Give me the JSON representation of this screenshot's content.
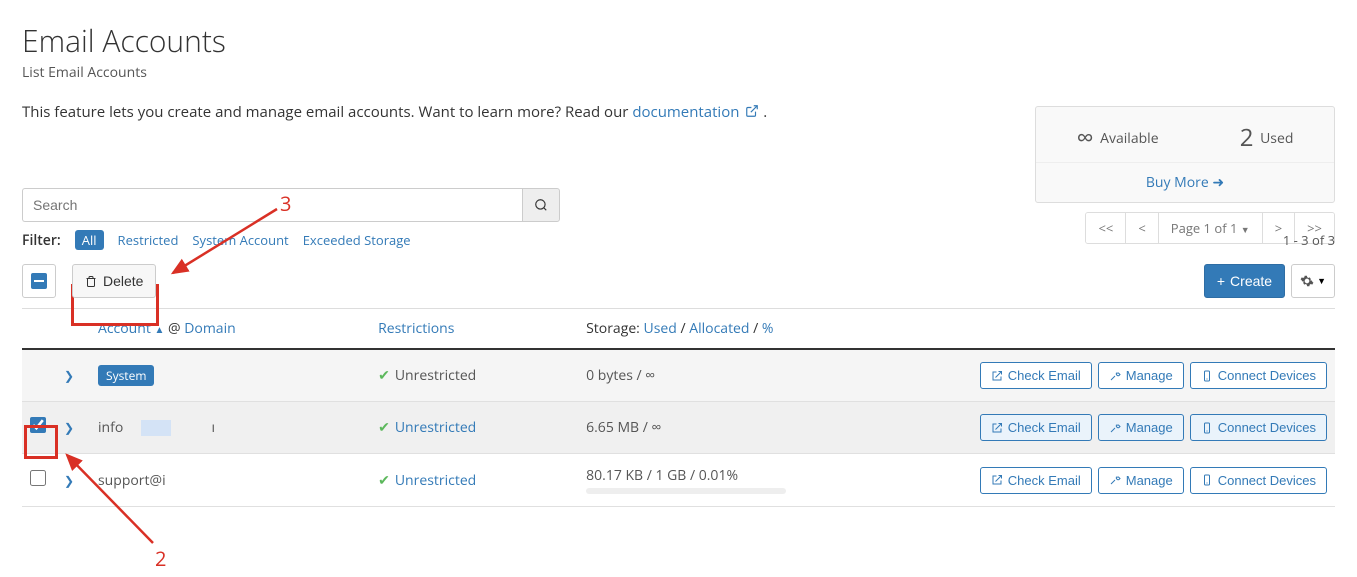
{
  "page": {
    "title": "Email Accounts",
    "subtitle": "List Email Accounts",
    "intro_prefix": "This feature lets you create and manage email accounts. Want to learn more? Read our ",
    "doc_link": "documentation",
    "intro_suffix": "."
  },
  "stats": {
    "available_value": "∞",
    "available_label": "Available",
    "used_value": "2",
    "used_label": "Used",
    "buy_more": "Buy More"
  },
  "search": {
    "placeholder": "Search"
  },
  "filters": {
    "label": "Filter:",
    "all": "All",
    "restricted": "Restricted",
    "system": "System Account",
    "exceeded": "Exceeded Storage"
  },
  "pager": {
    "first": "<<",
    "prev": "<",
    "page_label": "Page 1 of 1",
    "next": ">",
    "last": ">>",
    "range": "1 - 3 of 3"
  },
  "toolbar": {
    "delete_label": "Delete",
    "create_label": "Create"
  },
  "headers": {
    "account": "Account",
    "at": "@",
    "domain": "Domain",
    "restrictions": "Restrictions",
    "storage_label": "Storage:",
    "used": "Used",
    "allocated": "Allocated",
    "percent": "%",
    "sep": "/"
  },
  "row_buttons": {
    "check_email": "Check Email",
    "manage": "Manage",
    "connect": "Connect Devices"
  },
  "rows": [
    {
      "system_badge": "System",
      "restriction": "Unrestricted",
      "restriction_link": false,
      "storage": "0 bytes / ∞",
      "checkbox": false,
      "selected": false
    },
    {
      "account": "info",
      "restriction": "Unrestricted",
      "restriction_link": true,
      "storage": "6.65 MB / ∞",
      "checkbox": true,
      "selected": true
    },
    {
      "account": "support@i",
      "restriction": "Unrestricted",
      "restriction_link": true,
      "storage": "80.17 KB / 1 GB / 0.01%",
      "checkbox": true,
      "selected": false,
      "progress": true
    }
  ],
  "annotations": {
    "n2": "2",
    "n3": "3"
  }
}
